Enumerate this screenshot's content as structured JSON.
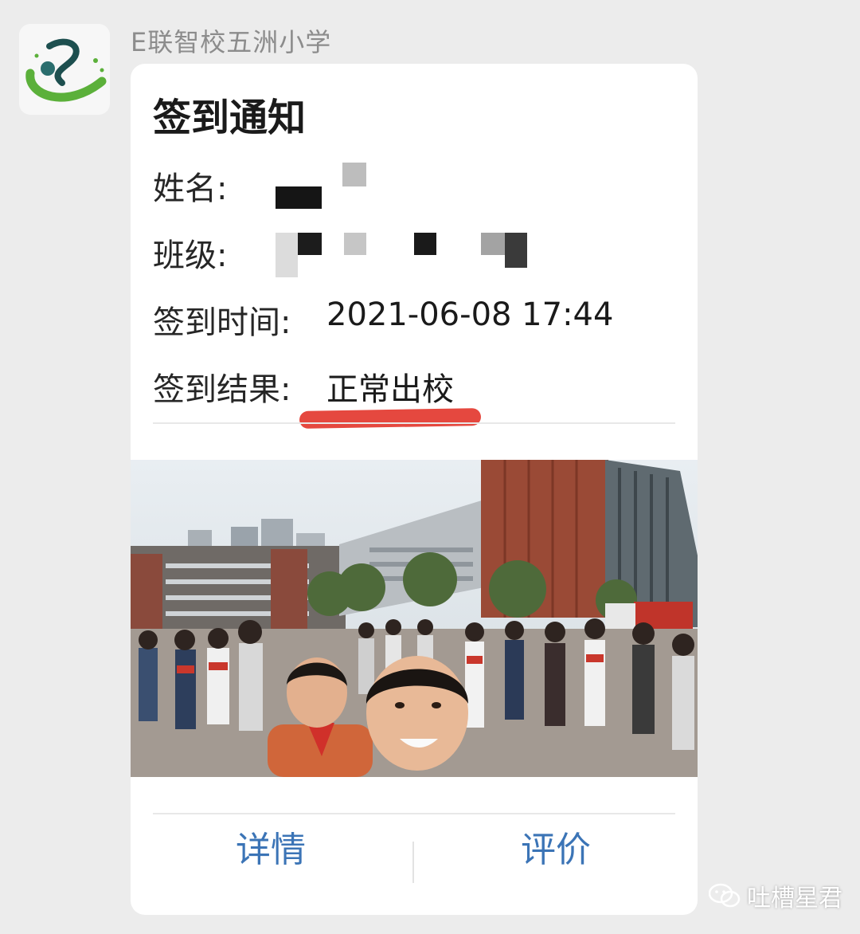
{
  "sender": {
    "name": "E联智校五洲小学"
  },
  "card": {
    "title": "签到通知",
    "fields": [
      {
        "label": "姓名:",
        "value": ""
      },
      {
        "label": "班级:",
        "value": ""
      },
      {
        "label": "签到时间:",
        "value": "2021-06-08 17:44"
      },
      {
        "label": "签到结果:",
        "value": "正常出校"
      }
    ]
  },
  "actions": {
    "details": "详情",
    "review": "评价"
  },
  "watermark": {
    "text": "吐槽星君",
    "icon": "wechat-icon"
  },
  "colors": {
    "link": "#3b74b6",
    "highlight": "#e5483f",
    "logo_green": "#5bb03a"
  }
}
